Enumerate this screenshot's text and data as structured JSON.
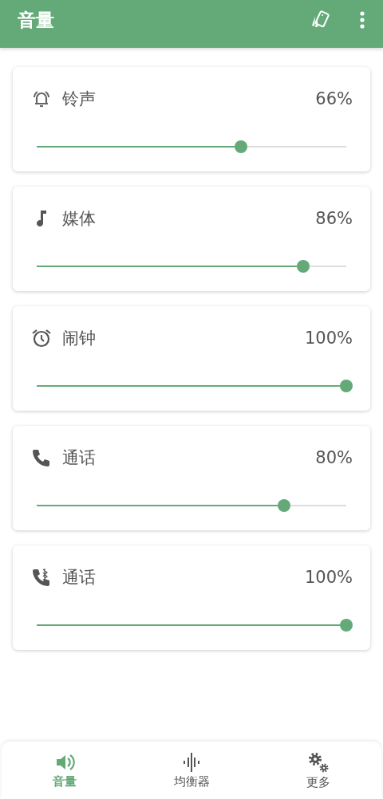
{
  "app_bar": {
    "title": "音量"
  },
  "channels": [
    {
      "kind": "ringtone",
      "name": "铃声",
      "reading": "66%",
      "level": 0.66
    },
    {
      "kind": "media",
      "name": "媒体",
      "reading": "86%",
      "level": 0.86
    },
    {
      "kind": "alarm",
      "name": "闹钟",
      "reading": "100%",
      "level": 1
    },
    {
      "kind": "call",
      "name": "通话",
      "reading": "80%",
      "level": 0.8
    },
    {
      "kind": "bluetooth-call",
      "name": "通话",
      "reading": "100%",
      "level": 1
    }
  ],
  "bottom_nav": [
    {
      "kind": "volume",
      "label": "音量",
      "selected": true
    },
    {
      "kind": "equalizer",
      "label": "均衡器",
      "selected": false
    },
    {
      "kind": "more",
      "label": "更多",
      "selected": false
    }
  ]
}
